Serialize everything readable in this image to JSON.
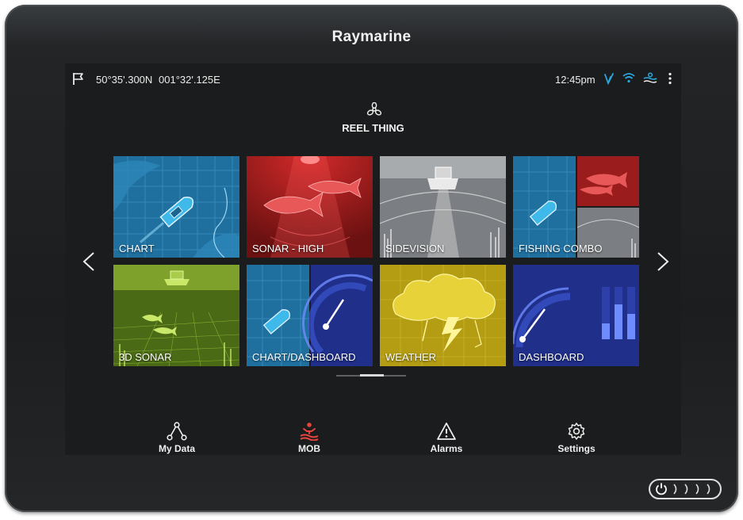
{
  "brand": "Raymarine",
  "status": {
    "latitude": "50°35'.300N",
    "longitude": "001°32'.125E",
    "time": "12:45pm",
    "icons": [
      "flag-icon",
      "fish-tail-icon",
      "wifi-icon",
      "tide-icon",
      "more-vertical-icon"
    ]
  },
  "vessel": {
    "name": "REEL THING",
    "icon": "propeller-icon"
  },
  "apps": [
    {
      "label": "CHART"
    },
    {
      "label": "SONAR - HIGH"
    },
    {
      "label": "SIDEVISION"
    },
    {
      "label": "FISHING COMBO"
    },
    {
      "label": "3D SONAR"
    },
    {
      "label": "CHART/DASHBOARD"
    },
    {
      "label": "WEATHER"
    },
    {
      "label": "DASHBOARD"
    }
  ],
  "navigation": {
    "prev_icon": "chevron-left-icon",
    "next_icon": "chevron-right-icon"
  },
  "bottom_nav": [
    {
      "label": "My Data",
      "icon": "network-icon"
    },
    {
      "label": "MOB",
      "icon": "man-overboard-icon"
    },
    {
      "label": "Alarms",
      "icon": "warning-icon"
    },
    {
      "label": "Settings",
      "icon": "gear-icon"
    }
  ],
  "colors": {
    "mob": "#e8453c",
    "accent": "#2aa7e0"
  },
  "power_button": {
    "icon": "power-icon"
  }
}
